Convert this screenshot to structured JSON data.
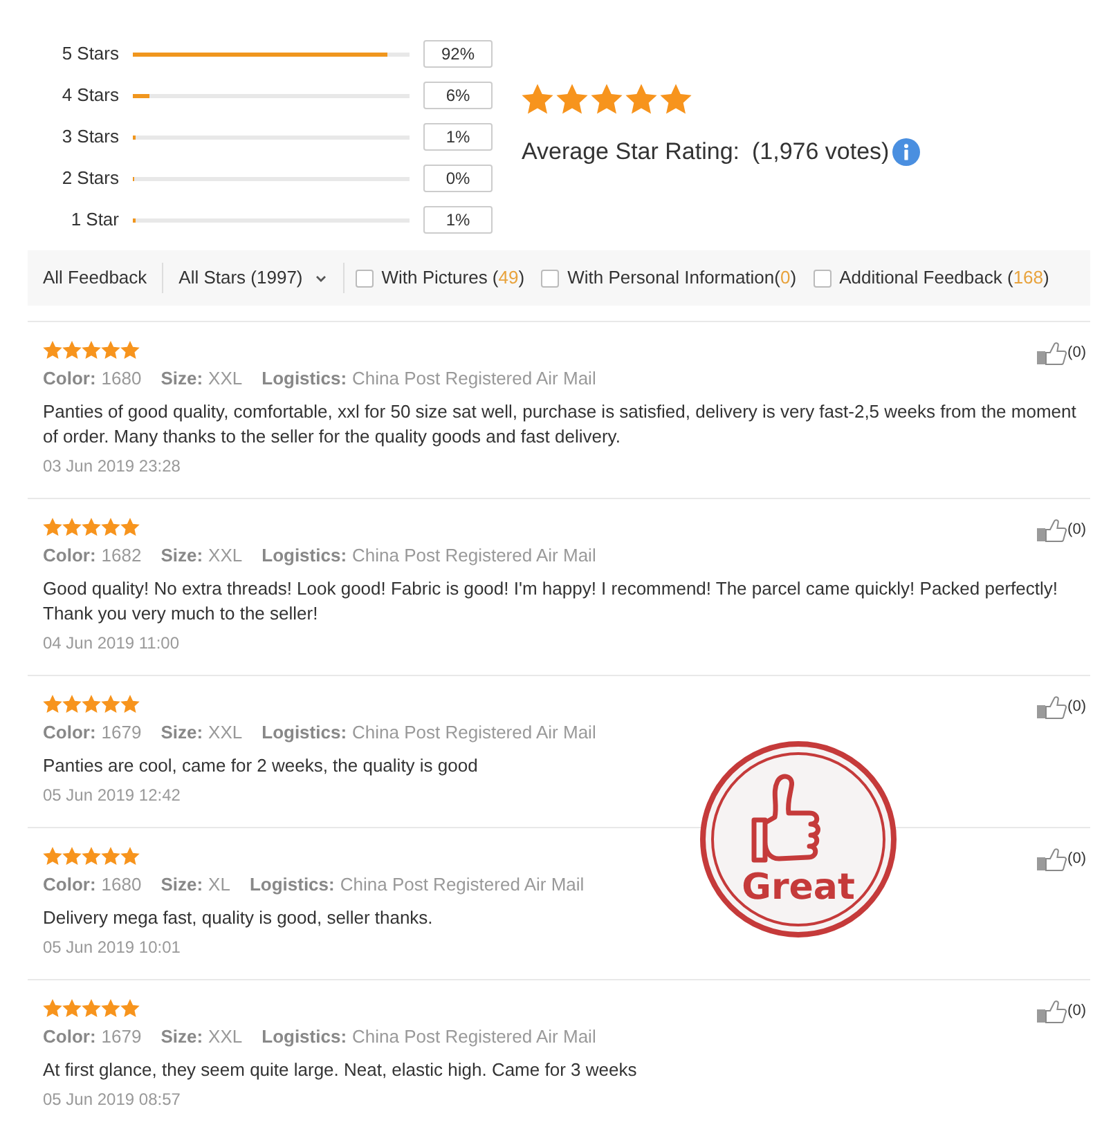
{
  "rating_breakdown": [
    {
      "label": "5 Stars",
      "level": 0.92,
      "percent": "92%"
    },
    {
      "label": "4 Stars",
      "level": 0.06,
      "percent": "6%"
    },
    {
      "label": "3 Stars",
      "level": 0.01,
      "percent": "1%"
    },
    {
      "label": "2 Stars",
      "level": 0,
      "percent": "0%"
    },
    {
      "label": "1 Star",
      "level": 0.01,
      "percent": "1%"
    }
  ],
  "summary": {
    "stars": 5,
    "label": "Average Star Rating:",
    "votes": "(1,976 votes)"
  },
  "filters": {
    "all_feedback": "All Feedback",
    "star_filter": "All Stars (1997)",
    "options": [
      {
        "label": "With Pictures (",
        "count": "49",
        "label_end": ")",
        "checked": false
      },
      {
        "label": "With Personal Information(",
        "count": "0",
        "label_end": ")",
        "checked": false
      },
      {
        "label": "Additional Feedback (",
        "count": "168",
        "label_end": ")",
        "checked": false
      }
    ]
  },
  "reviews": [
    {
      "stars": 5,
      "details": [
        {
          "label": "Color:",
          "value": "1680"
        },
        {
          "label": "Size:",
          "value": "XXL"
        },
        {
          "label": "Logistics:",
          "value": "China Post Registered Air Mail"
        }
      ],
      "text": "Panties of good quality, comfortable, xxl for 50 size sat well, purchase is satisfied, delivery is very fast-2,5 weeks from the moment of order. Many thanks to the seller for the quality goods and fast delivery.",
      "date": "03 Jun 2019 23:28",
      "helpful": "(0)"
    },
    {
      "stars": 5,
      "details": [
        {
          "label": "Color:",
          "value": "1682"
        },
        {
          "label": "Size:",
          "value": "XXL"
        },
        {
          "label": "Logistics:",
          "value": "China Post Registered Air Mail"
        }
      ],
      "text": "Good quality! No extra threads! Look good! Fabric is good! I'm happy! I recommend! The parcel came quickly! Packed perfectly! Thank you very much to the seller!",
      "date": "04 Jun 2019 11:00",
      "helpful": "(0)"
    },
    {
      "stars": 5,
      "details": [
        {
          "label": "Color:",
          "value": "1679"
        },
        {
          "label": "Size:",
          "value": "XXL"
        },
        {
          "label": "Logistics:",
          "value": "China Post Registered Air Mail"
        }
      ],
      "text": "Panties are cool, came for 2 weeks, the quality is good",
      "date": "05 Jun 2019 12:42",
      "helpful": "(0)"
    },
    {
      "stars": 5,
      "details": [
        {
          "label": "Color:",
          "value": "1680"
        },
        {
          "label": "Size:",
          "value": "XL"
        },
        {
          "label": "Logistics:",
          "value": "China Post Registered Air Mail"
        }
      ],
      "text": "Delivery mega fast, quality is good, seller thanks.",
      "date": "05 Jun 2019 10:01",
      "helpful": "(0)"
    },
    {
      "stars": 5,
      "details": [
        {
          "label": "Color:",
          "value": "1679"
        },
        {
          "label": "Size:",
          "value": "XXL"
        },
        {
          "label": "Logistics:",
          "value": "China Post Registered Air Mail"
        }
      ],
      "text": "At first glance, they seem quite large. Neat, elastic high. Came for 3 weeks",
      "date": "05 Jun 2019 08:57",
      "helpful": "(0)"
    }
  ],
  "stamp": {
    "text": "Great"
  }
}
